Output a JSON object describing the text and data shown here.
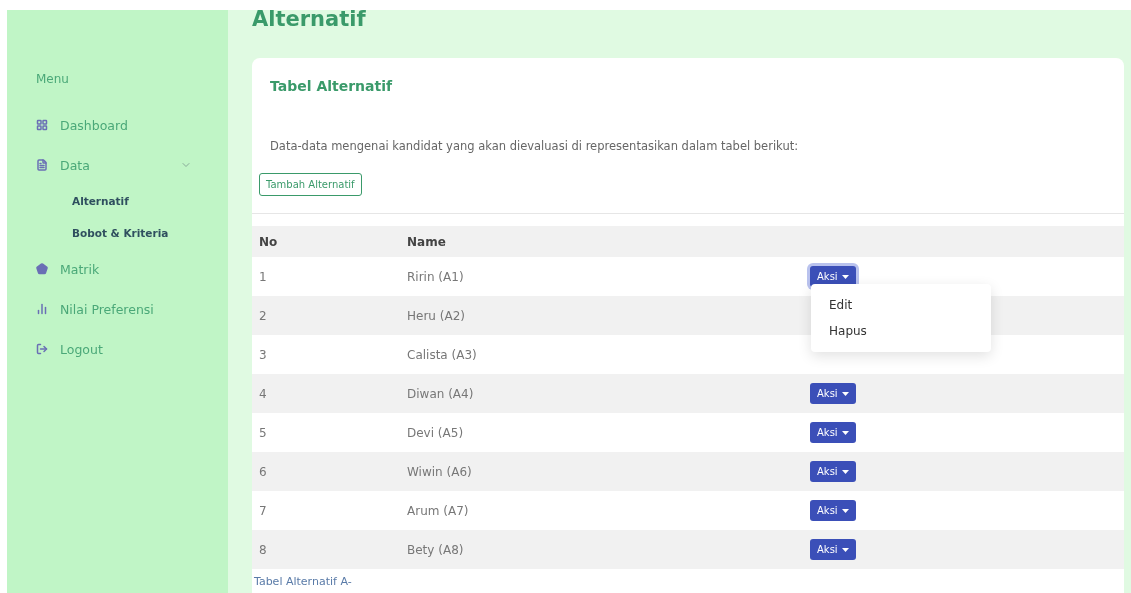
{
  "sidebar": {
    "heading": "Menu",
    "items": [
      {
        "kind": "grid",
        "label": "Dashboard"
      },
      {
        "kind": "file",
        "label": "Data",
        "expanded": true,
        "children": [
          {
            "label": "Alternatif"
          },
          {
            "label": "Bobot & Kriteria"
          }
        ]
      },
      {
        "kind": "pentagon",
        "label": "Matrik"
      },
      {
        "kind": "chart",
        "label": "Nilai Preferensi"
      },
      {
        "kind": "logout",
        "label": "Logout"
      }
    ]
  },
  "page_title": "Alternatif",
  "card": {
    "title": "Tabel Alternatif",
    "description": "Data-data mengenai kandidat yang akan dievaluasi di representasikan dalam tabel berikut:",
    "add_button": "Tambah Alternatif",
    "table": {
      "columns": [
        "No",
        "Name"
      ],
      "rows": [
        {
          "no": "1",
          "name": "Ririn (A1)",
          "action": "Aksi",
          "menu_open": true,
          "menu": [
            "Edit",
            "Hapus"
          ]
        },
        {
          "no": "2",
          "name": "Heru (A2)"
        },
        {
          "no": "3",
          "name": "Calista (A3)"
        },
        {
          "no": "4",
          "name": "Diwan (A4)",
          "action": "Aksi",
          "menu_open": false
        },
        {
          "no": "5",
          "name": "Devi (A5)",
          "action": "Aksi",
          "menu_open": false
        },
        {
          "no": "6",
          "name": "Wiwin (A6)",
          "action": "Aksi",
          "menu_open": false
        },
        {
          "no": "7",
          "name": "Arum (A7)",
          "action": "Aksi",
          "menu_open": false
        },
        {
          "no": "8",
          "name": "Bety (A8)",
          "action": "Aksi",
          "menu_open": false
        }
      ]
    },
    "caption": "Tabel Alternatif A-"
  }
}
